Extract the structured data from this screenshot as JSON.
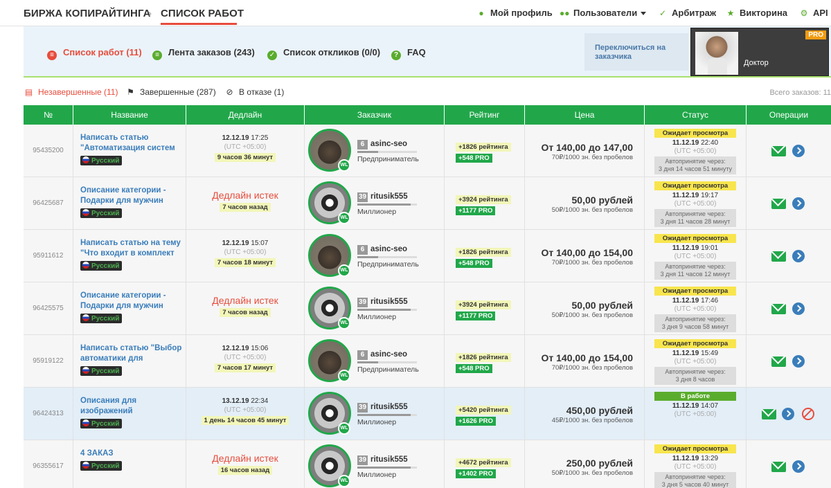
{
  "breadcrumb": {
    "root": "БИРЖА КОПИРАЙТИНГА",
    "separator": "›",
    "current": "СПИСОК РАБОТ"
  },
  "topnav": [
    {
      "label": "Мой профиль",
      "icon": "user-icon"
    },
    {
      "label": "Пользователи",
      "icon": "users-icon"
    },
    {
      "label": "Арбитраж",
      "icon": "gavel-icon"
    },
    {
      "label": "Викторина",
      "icon": "trophy-icon"
    },
    {
      "label": "API",
      "icon": "gear-icon"
    }
  ],
  "tabs": [
    {
      "label": "Список работ (11)",
      "icon": "list-icon",
      "color": "#e74c3c"
    },
    {
      "label": "Лента заказов (243)",
      "icon": "feed-icon",
      "color": "#5aac2d"
    },
    {
      "label": "Список откликов (0/0)",
      "icon": "responses-icon",
      "color": "#5aac2d"
    },
    {
      "label": "FAQ",
      "icon": "question-icon",
      "color": "#5aac2d"
    }
  ],
  "switch_label": "Переключиться на заказчика",
  "profile": {
    "name": "Доктор",
    "badge": "PRO"
  },
  "filters": [
    {
      "label": "Незавершенные (11)",
      "icon": "list-icon"
    },
    {
      "label": "Завершенные (287)",
      "icon": "flag-icon"
    },
    {
      "label": "В отказе (1)",
      "icon": "block-icon"
    }
  ],
  "total_orders": "Всего заказов: 11",
  "columns": [
    "№",
    "Название",
    "Дедлайн",
    "Заказчик",
    "Рейтинг",
    "Цена",
    "Статус",
    "Операции"
  ],
  "rows": [
    {
      "id": "95435200",
      "title": "Написать статью \"Автоматизация систем",
      "lang": "Русский",
      "dl_date": "12.12.19",
      "dl_time": "17:25",
      "dl_utc": "(UTC +05:00)",
      "dl_left": "9 часов 36 минут",
      "expired": false,
      "avatar": "wolf",
      "level": "6",
      "user": "asinc-seo",
      "user_status": "Предприниматель",
      "level_progress": 0.35,
      "rating1": "+1826 рейтинга",
      "rating2": "+548 PRO",
      "price": "От 140,00 до 147,00",
      "price_sub": "70₽/1000 зн. без пробелов",
      "status": "Ожидает просмотра",
      "status_type": "waiting",
      "st_date": "11.12.19",
      "st_time": "22:40",
      "st_utc": "(UTC +05:00)",
      "st_auto_label": "Автопринятие через:",
      "st_auto": "3 дня 14 часов 51 минуту",
      "cancel": false
    },
    {
      "id": "96425687",
      "title": "Описание категории - Подарки для мужчин",
      "lang": "Русский",
      "dl_expired_text": "Дедлайн истек",
      "dl_left": "7 часов назад",
      "expired": true,
      "avatar": "racoon",
      "level": "39",
      "user": "ritusik555",
      "user_status": "Миллионер",
      "level_progress": 0.9,
      "rating1": "+3924 рейтинга",
      "rating2": "+1177 PRO",
      "price": "50,00 рублей",
      "price_sub": "50₽/1000 зн. без пробелов",
      "status": "Ожидает просмотра",
      "status_type": "waiting",
      "st_date": "11.12.19",
      "st_time": "19:17",
      "st_utc": "(UTC +05:00)",
      "st_auto_label": "Автопринятие через:",
      "st_auto": "3 дня 11 часов 28 минут",
      "cancel": false
    },
    {
      "id": "95911612",
      "title": "Написать статью на тему \"Что входит в комплект",
      "lang": "Русский",
      "dl_date": "12.12.19",
      "dl_time": "15:07",
      "dl_utc": "(UTC +05:00)",
      "dl_left": "7 часов 18 минут",
      "expired": false,
      "avatar": "wolf",
      "level": "6",
      "user": "asinc-seo",
      "user_status": "Предприниматель",
      "level_progress": 0.35,
      "rating1": "+1826 рейтинга",
      "rating2": "+548 PRO",
      "price": "От 140,00 до 154,00",
      "price_sub": "70₽/1000 зн. без пробелов",
      "status": "Ожидает просмотра",
      "status_type": "waiting",
      "st_date": "11.12.19",
      "st_time": "19:01",
      "st_utc": "(UTC +05:00)",
      "st_auto_label": "Автопринятие через:",
      "st_auto": "3 дня 11 часов 12 минут",
      "cancel": false
    },
    {
      "id": "96425575",
      "title": "Описание категории - Подарки для мужчин",
      "lang": "Русский",
      "dl_expired_text": "Дедлайн истек",
      "dl_left": "7 часов назад",
      "expired": true,
      "avatar": "racoon",
      "level": "39",
      "user": "ritusik555",
      "user_status": "Миллионер",
      "level_progress": 0.9,
      "rating1": "+3924 рейтинга",
      "rating2": "+1177 PRO",
      "price": "50,00 рублей",
      "price_sub": "50₽/1000 зн. без пробелов",
      "status": "Ожидает просмотра",
      "status_type": "waiting",
      "st_date": "11.12.19",
      "st_time": "17:46",
      "st_utc": "(UTC +05:00)",
      "st_auto_label": "Автопринятие через:",
      "st_auto": "3 дня 9 часов 58 минут",
      "cancel": false
    },
    {
      "id": "95919122",
      "title": "Написать статью \"Выбор автоматики для",
      "lang": "Русский",
      "dl_date": "12.12.19",
      "dl_time": "15:06",
      "dl_utc": "(UTC +05:00)",
      "dl_left": "7 часов 17 минут",
      "expired": false,
      "avatar": "wolf",
      "level": "6",
      "user": "asinc-seo",
      "user_status": "Предприниматель",
      "level_progress": 0.35,
      "rating1": "+1826 рейтинга",
      "rating2": "+548 PRO",
      "price": "От 140,00 до 154,00",
      "price_sub": "70₽/1000 зн. без пробелов",
      "status": "Ожидает просмотра",
      "status_type": "waiting",
      "st_date": "11.12.19",
      "st_time": "15:49",
      "st_utc": "(UTC +05:00)",
      "st_auto_label": "Автопринятие через:",
      "st_auto": "3 дня 8 часов",
      "cancel": false
    },
    {
      "id": "96424313",
      "title": "Описания для изображений",
      "lang": "Русский",
      "highlight": true,
      "dl_date": "13.12.19",
      "dl_time": "22:34",
      "dl_utc": "(UTC +05:00)",
      "dl_left": "1 день 14 часов 45 минут",
      "expired": false,
      "avatar": "racoon",
      "level": "39",
      "user": "ritusik555",
      "user_status": "Миллионер",
      "level_progress": 0.9,
      "rating1": "+5420 рейтинга",
      "rating2": "+1626 PRO",
      "price": "450,00 рублей",
      "price_sub": "45₽/1000 зн. без пробелов",
      "status": "В работе",
      "status_type": "work",
      "st_date": "11.12.19",
      "st_time": "14:07",
      "st_utc": "(UTC +05:00)",
      "cancel": true
    },
    {
      "id": "96355617",
      "title": "4 ЗАКАЗ",
      "lang": "Русский",
      "dl_expired_text": "Дедлайн истек",
      "dl_left": "16 часов назад",
      "expired": true,
      "avatar": "racoon",
      "level": "39",
      "user": "ritusik555",
      "user_status": "Миллионер",
      "level_progress": 0.9,
      "rating1": "+4672 рейтинга",
      "rating2": "+1402 PRO",
      "price": "250,00 рублей",
      "price_sub": "50₽/1000 зн. без пробелов",
      "status": "Ожидает просмотра",
      "status_type": "waiting",
      "st_date": "11.12.19",
      "st_time": "13:29",
      "st_utc": "(UTC +05:00)",
      "st_auto_label": "Автопринятие через:",
      "st_auto": "3 дня 5 часов 40 минут",
      "cancel": false
    }
  ],
  "colors": {
    "accent_green": "#21a74a",
    "accent_red": "#e74c3c",
    "link_blue": "#3a7dba",
    "band_bg": "#eaf3fa"
  }
}
